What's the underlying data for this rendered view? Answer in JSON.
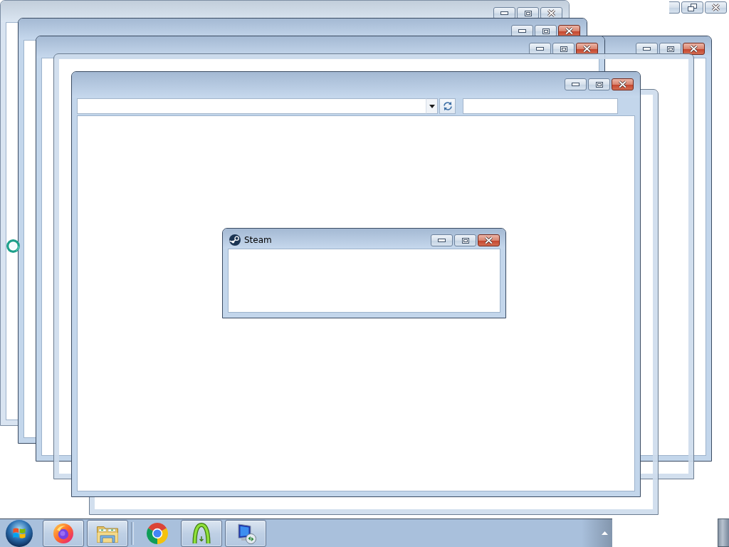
{
  "windows": [
    {
      "kind": "frame",
      "focused": false,
      "maximized": false
    },
    {
      "kind": "caption",
      "focused": false,
      "maximized": true
    },
    {
      "kind": "frame",
      "focused": true,
      "maximized": false
    },
    {
      "kind": "frame",
      "focused": true,
      "maximized": false
    },
    {
      "kind": "frame",
      "focused": true,
      "maximized": false
    },
    {
      "kind": "ghost"
    },
    {
      "kind": "ghost"
    },
    {
      "kind": "explorer",
      "focused": true,
      "maximized": false
    }
  ],
  "dialog": {
    "title": "Steam",
    "focused": true,
    "maximized": false
  },
  "taskbar": {
    "items": [
      {
        "kind": "fox",
        "running": true
      },
      {
        "kind": "folder",
        "running": true
      },
      {
        "kind": "ring",
        "running": false
      },
      {
        "kind": "arch",
        "running": true
      },
      {
        "kind": "monitor",
        "running": true
      }
    ]
  }
}
